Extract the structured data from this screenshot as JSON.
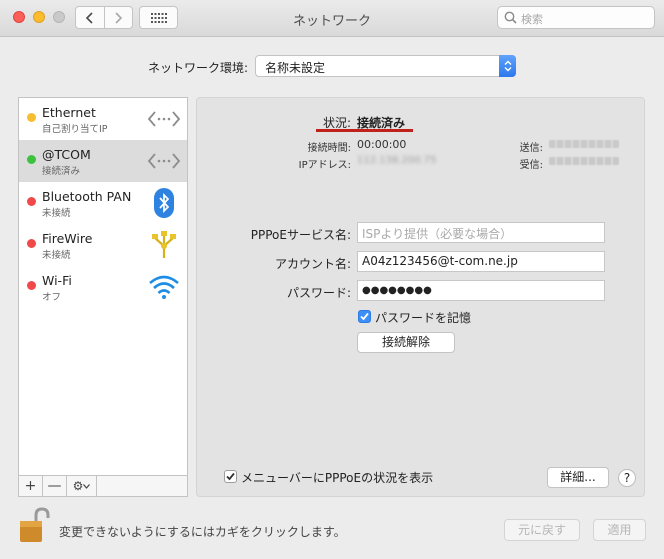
{
  "window": {
    "title": "ネットワーク"
  },
  "search": {
    "placeholder": "検索"
  },
  "location": {
    "label": "ネットワーク環境:",
    "value": "名称未設定"
  },
  "colors": {
    "accent": "#2d78ec",
    "status_red": "#c0211b",
    "dot_yellow": "#f7be2f",
    "dot_green": "#3fc140",
    "dot_red": "#f04949"
  },
  "services": [
    {
      "name": "Ethernet",
      "status": "自己割り当てIP",
      "dot": "yellow",
      "icon": "ethernet-arrows-icon"
    },
    {
      "name": "@TCOM",
      "status": "接続済み",
      "dot": "green",
      "icon": "ethernet-arrows-icon"
    },
    {
      "name": "Bluetooth PAN",
      "status": "未接続",
      "dot": "red",
      "icon": "bluetooth-icon"
    },
    {
      "name": "FireWire",
      "status": "未接続",
      "dot": "red",
      "icon": "firewire-icon"
    },
    {
      "name": "Wi-Fi",
      "status": "オフ",
      "dot": "red",
      "icon": "wifi-icon"
    }
  ],
  "list_toolbar": {
    "add": "+",
    "remove": "—",
    "gear": "⚙"
  },
  "detail": {
    "status_label": "状況:",
    "status_value": "接続済み",
    "connect_time_label": "接続時間:",
    "connect_time_value": "00:00:00",
    "ip_label": "IPアドレス:",
    "ip_value": "112.138.200.75",
    "sent_label": "送信:",
    "received_label": "受信:",
    "pppoe_service_label": "PPPoEサービス名:",
    "pppoe_service_placeholder": "ISPより提供（必要な場合）",
    "account_label": "アカウント名:",
    "account_value": "A04z123456@t-com.ne.jp",
    "password_label": "パスワード:",
    "password_value": "●●●●●●●●",
    "remember_password_label": "パスワードを記憶",
    "remember_password_checked": true,
    "disconnect_button": "接続解除",
    "show_menu_label": "メニューバーにPPPoEの状況を表示",
    "show_menu_checked": true,
    "advanced_button": "詳細...",
    "help_button": "?"
  },
  "footer": {
    "lock_text": "変更できないようにするにはカギをクリックします。",
    "revert_button": "元に戻す",
    "apply_button": "適用"
  }
}
